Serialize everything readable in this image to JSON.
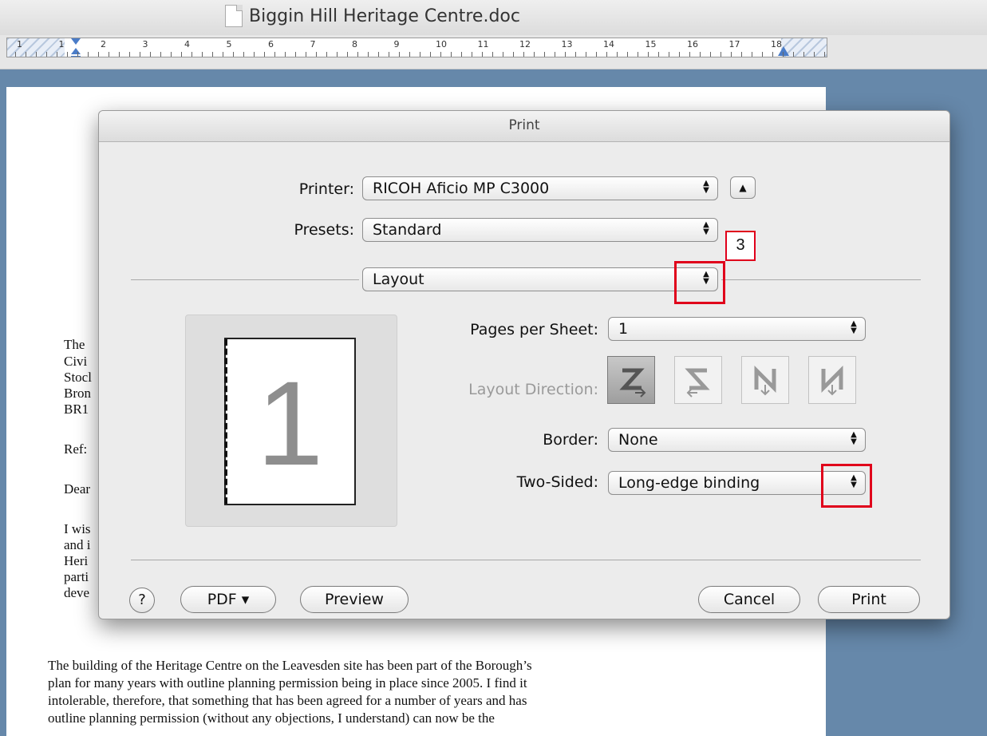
{
  "window": {
    "title": "Biggin Hill Heritage Centre.doc",
    "doc_icon": "document-icon"
  },
  "ruler": {
    "numbers": [
      "1",
      "1",
      "2",
      "3",
      "4",
      "5",
      "6",
      "7",
      "8",
      "9",
      "10",
      "11",
      "12",
      "13",
      "14",
      "15",
      "16",
      "17",
      "18"
    ]
  },
  "document": {
    "left_fragments": [
      "The",
      "Civi",
      "Stocl",
      "Bron",
      "BR1",
      "Ref:",
      "Dear",
      "I wis",
      "and i",
      "Heri",
      "parti",
      "deve"
    ],
    "body_lines": [
      "The building of the Heritage Centre on the Leavesden site has been part of the Borough’s",
      "plan for many years with outline planning permission being in place since 2005. I find it",
      "intolerable, therefore, that something that has been agreed for a number of years and has",
      "outline planning permission (without any objections, I understand) can now be the"
    ]
  },
  "dialog": {
    "title": "Print",
    "printer": {
      "label": "Printer:",
      "value": "RICOH Aficio MP C3000"
    },
    "presets": {
      "label": "Presets:",
      "value": "Standard"
    },
    "panel": {
      "value": "Layout"
    },
    "annotation": {
      "step": "3"
    },
    "preview": {
      "page_number": "1"
    },
    "pages_per_sheet": {
      "label": "Pages per Sheet:",
      "value": "1"
    },
    "layout_direction": {
      "label": "Layout Direction:"
    },
    "border": {
      "label": "Border:",
      "value": "None"
    },
    "two_sided": {
      "label": "Two-Sided:",
      "value": "Long-edge binding"
    },
    "buttons": {
      "help": "?",
      "pdf": "PDF ▾",
      "preview": "Preview",
      "cancel": "Cancel",
      "print": "Print"
    }
  },
  "colors": {
    "workspace": "#6688aa",
    "annotation_red": "#e0001b"
  }
}
